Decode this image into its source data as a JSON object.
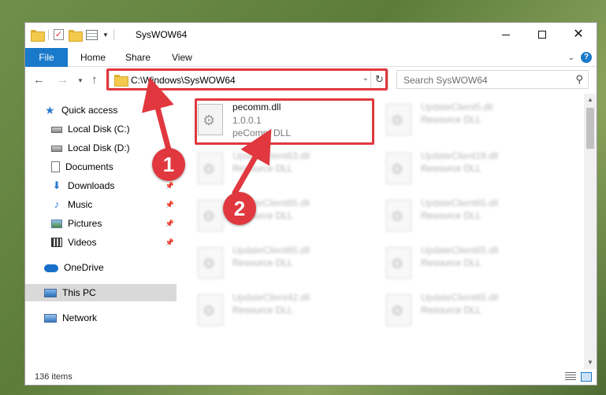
{
  "window": {
    "title": "SysWOW64"
  },
  "ribbon": {
    "file": "File",
    "tabs": [
      "Home",
      "Share",
      "View"
    ]
  },
  "address": {
    "path": "C:\\Windows\\SysWOW64"
  },
  "search": {
    "placeholder": "Search SysWOW64"
  },
  "sidebar": {
    "items": [
      {
        "label": "Quick access",
        "icon": "star-icon",
        "pinned": false
      },
      {
        "label": "Local Disk (C:)",
        "icon": "drive-icon",
        "pinned": false
      },
      {
        "label": "Local Disk (D:)",
        "icon": "drive-icon",
        "pinned": false
      },
      {
        "label": "Documents",
        "icon": "documents-icon",
        "pinned": false
      },
      {
        "label": "Downloads",
        "icon": "downloads-icon",
        "pinned": true
      },
      {
        "label": "Music",
        "icon": "music-icon",
        "pinned": true
      },
      {
        "label": "Pictures",
        "icon": "pictures-icon",
        "pinned": true
      },
      {
        "label": "Videos",
        "icon": "videos-icon",
        "pinned": true
      },
      {
        "label": "OneDrive",
        "icon": "onedrive-icon",
        "pinned": false
      },
      {
        "label": "This PC",
        "icon": "this-pc-icon",
        "pinned": false,
        "selected": true
      },
      {
        "label": "Network",
        "icon": "network-icon",
        "pinned": false
      }
    ]
  },
  "files": [
    {
      "name": "pecomm.dll",
      "version": "1.0.0.1",
      "desc": "peComm DLL"
    },
    {
      "name": "UpdateClient5.dll",
      "desc": "Resource DLL"
    },
    {
      "name": "UpdateClient63.dll",
      "desc": "Resource DLL"
    },
    {
      "name": "UpdateClient19.dll",
      "desc": "Resource DLL"
    },
    {
      "name": "UpdateClient65.dll",
      "desc": "Resource DLL"
    },
    {
      "name": "UpdateClient65.dll",
      "desc": "Resource DLL"
    },
    {
      "name": "UpdateClient65.dll",
      "desc": "Resource DLL"
    },
    {
      "name": "UpdateClient65.dll",
      "desc": "Resource DLL"
    },
    {
      "name": "UpdateClient42.dll",
      "desc": "Resource DLL"
    },
    {
      "name": "UpdateClient65.dll",
      "desc": "Resource DLL"
    }
  ],
  "status": {
    "count": "136 items"
  },
  "callouts": [
    "1",
    "2"
  ],
  "colors": {
    "accent": "#1979ca",
    "highlight": "#e0383e",
    "selected": "#d9d9d9"
  }
}
